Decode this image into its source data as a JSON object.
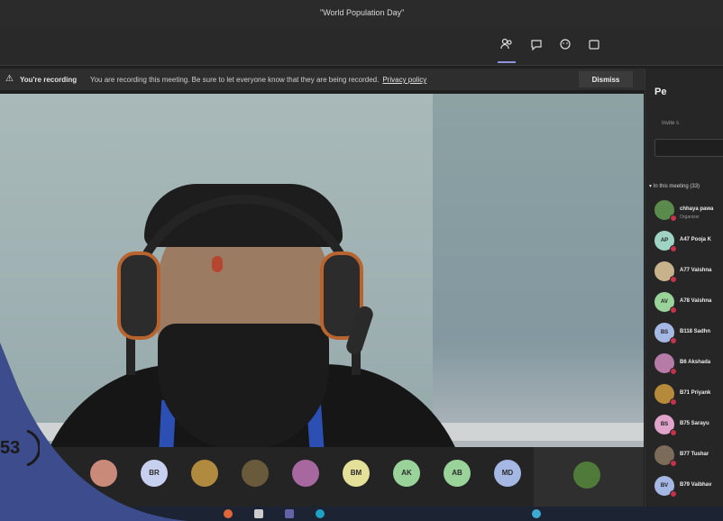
{
  "window": {
    "title": "\"World Population Day\""
  },
  "toolbar": {
    "icons": [
      "participants-icon",
      "chat-icon",
      "reactions-icon",
      "more-icon"
    ]
  },
  "banner": {
    "label": "You're recording",
    "message": "You are recording this meeting. Be sure to let everyone know that they are being recorded.",
    "policy": "Privacy policy",
    "dismiss": "Dismiss"
  },
  "participants_panel": {
    "title": "Pe",
    "invite_hint": "Invite s",
    "section": "In this meeting (33)",
    "people": [
      {
        "name": "chhaya pawa",
        "role": "Organizer",
        "initials": "",
        "color": "#5b8a4d"
      },
      {
        "name": "A47 Pooja K",
        "role": "",
        "initials": "AP",
        "color": "#9fd3c4"
      },
      {
        "name": "A77 Vaishna",
        "role": "",
        "initials": "",
        "color": "#c7b28c"
      },
      {
        "name": "A78 Vaishna",
        "role": "",
        "initials": "AV",
        "color": "#9ad39a"
      },
      {
        "name": "B118 Sadhn",
        "role": "",
        "initials": "BS",
        "color": "#a5b7e3"
      },
      {
        "name": "B6 Akshada",
        "role": "",
        "initials": "",
        "color": "#b77ba7"
      },
      {
        "name": "B71 Priyank",
        "role": "",
        "initials": "",
        "color": "#b58a3a"
      },
      {
        "name": "B75 Sarayu",
        "role": "",
        "initials": "BS",
        "color": "#e0a3c9"
      },
      {
        "name": "B77 Tushar",
        "role": "",
        "initials": "",
        "color": "#7a6c58"
      },
      {
        "name": "B79 Vaibhav",
        "role": "",
        "initials": "BV",
        "color": "#a5b7e3"
      }
    ]
  },
  "strip": {
    "avatars": [
      {
        "initials": "",
        "color": "#c98a7a"
      },
      {
        "initials": "BR",
        "color": "#c7d0ef"
      },
      {
        "initials": "",
        "color": "#b08a3e"
      },
      {
        "initials": "",
        "color": "#6a5a3c"
      },
      {
        "initials": "",
        "color": "#a7679f"
      },
      {
        "initials": "BM",
        "color": "#e4e09a"
      },
      {
        "initials": "AK",
        "color": "#9ad39a"
      },
      {
        "initials": "AB",
        "color": "#9ad39a"
      },
      {
        "initials": "MD",
        "color": "#a5b7e3"
      }
    ]
  },
  "logo": {
    "text": "53"
  },
  "colors": {
    "frame_bg": "#3d4c8c",
    "accent": "#8f93e0",
    "recording": "#c4314b"
  }
}
